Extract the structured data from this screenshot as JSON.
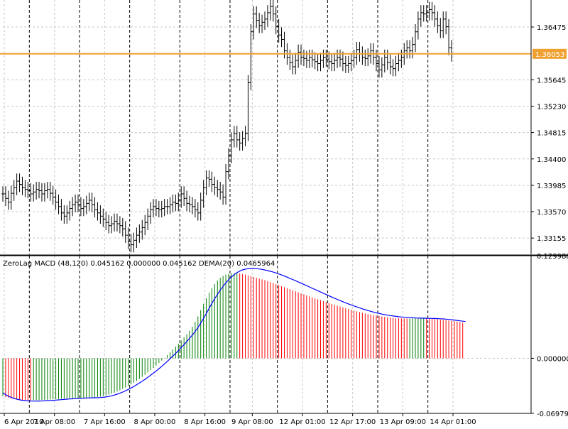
{
  "chart_data": [
    {
      "type": "ohlc",
      "title": "",
      "ylim": [
        1.329,
        1.369
      ],
      "y_ticks": [
        1.33155,
        1.3357,
        1.33985,
        1.344,
        1.34815,
        1.3523,
        1.35645,
        1.36475
      ],
      "y_tick_labels": [
        "1.33155",
        "1.33570",
        "1.33985",
        "1.34400",
        "1.34815",
        "1.35230",
        "1.35645",
        "1.36475"
      ],
      "current_price": 1.36053,
      "current_price_label": "1.36053",
      "price_line_color": "#f0a030",
      "bar_color": "#000000",
      "series": [
        {
          "close": [
            1.3385,
            1.3378,
            1.3372,
            1.3386,
            1.3395,
            1.3405,
            1.34,
            1.3395,
            1.3392,
            1.339,
            1.3385,
            1.3388,
            1.3392,
            1.339,
            1.3385,
            1.339,
            1.3392,
            1.3386,
            1.338,
            1.3372,
            1.3365,
            1.3355,
            1.335,
            1.3355,
            1.3362,
            1.3368,
            1.3372,
            1.3368,
            1.3362,
            1.3365,
            1.337,
            1.3375,
            1.3368,
            1.336,
            1.3355,
            1.335,
            1.3345,
            1.334,
            1.3335,
            1.3338,
            1.3342,
            1.3338,
            1.3335,
            1.333,
            1.332,
            1.331,
            1.3305,
            1.3312,
            1.332,
            1.3325,
            1.3332,
            1.334,
            1.335,
            1.336,
            1.3365,
            1.3362,
            1.336,
            1.3362,
            1.3365,
            1.3365,
            1.3368,
            1.3372,
            1.337,
            1.3375,
            1.3385,
            1.3378,
            1.337,
            1.3368,
            1.3365,
            1.336,
            1.3355,
            1.3375,
            1.3395,
            1.341,
            1.3408,
            1.34,
            1.3395,
            1.3392,
            1.3388,
            1.338,
            1.342,
            1.3445,
            1.347,
            1.348,
            1.347,
            1.3465,
            1.3472,
            1.348,
            1.356,
            1.364,
            1.3668,
            1.3658,
            1.365,
            1.3655,
            1.366,
            1.367,
            1.368,
            1.3668,
            1.3648,
            1.3635,
            1.3628,
            1.361,
            1.36,
            1.3592,
            1.3585,
            1.3595,
            1.3608,
            1.36,
            1.3598,
            1.3595,
            1.36,
            1.3596,
            1.3593,
            1.359,
            1.3595,
            1.36,
            1.3597,
            1.3593,
            1.359,
            1.3595,
            1.36,
            1.3597,
            1.359,
            1.3587,
            1.359,
            1.3595,
            1.36,
            1.3612,
            1.3605,
            1.36,
            1.3598,
            1.3602,
            1.361,
            1.36,
            1.359,
            1.358,
            1.3588,
            1.36,
            1.3592,
            1.3585,
            1.3582,
            1.359,
            1.3595,
            1.36,
            1.361,
            1.3615,
            1.361,
            1.362,
            1.364,
            1.366,
            1.367,
            1.3668,
            1.367,
            1.3675,
            1.367,
            1.366,
            1.365,
            1.3642,
            1.366,
            1.3648,
            1.3615,
            1.3605
          ]
        }
      ],
      "x_tick_labels": [
        "6 Apr 2010",
        "7 Apr 08:00",
        "7 Apr 16:00",
        "8 Apr 00:00",
        "8 Apr 16:00",
        "9 Apr 08:00",
        "12 Apr 01:00",
        "12 Apr 17:00",
        "13 Apr 09:00",
        "14 Apr 01:00"
      ],
      "period_separators": 9
    },
    {
      "type": "bar",
      "title": "ZeroLag MACD (48,120) 0.045162 0.000000 0.045162 DEMA(20) 0.0465964",
      "ylim": [
        -0.06979,
        0.129988
      ],
      "y_ticks": [
        0.129988,
        0.0,
        -0.06979
      ],
      "y_tick_labels": [
        "0.129988",
        "0.000000",
        "-0.069790"
      ],
      "series": [
        {
          "name": "ZeroLag MACD",
          "colors": {
            "rising": "#008000",
            "falling": "#ff0000"
          },
          "values": [
            -0.048,
            -0.049,
            -0.05,
            -0.0508,
            -0.0515,
            -0.052,
            -0.0525,
            -0.0528,
            -0.053,
            -0.0532,
            -0.0533,
            -0.0532,
            -0.0531,
            -0.053,
            -0.0528,
            -0.0526,
            -0.0524,
            -0.0522,
            -0.052,
            -0.0518,
            -0.0515,
            -0.0513,
            -0.0511,
            -0.051,
            -0.0508,
            -0.0507,
            -0.0506,
            -0.0505,
            -0.0504,
            -0.0503,
            -0.0502,
            -0.05,
            -0.0497,
            -0.0494,
            -0.049,
            -0.0485,
            -0.0478,
            -0.047,
            -0.046,
            -0.0448,
            -0.0435,
            -0.042,
            -0.0405,
            -0.0388,
            -0.037,
            -0.035,
            -0.033,
            -0.0308,
            -0.0285,
            -0.026,
            -0.0235,
            -0.0208,
            -0.018,
            -0.0152,
            -0.0122,
            -0.0092,
            -0.006,
            -0.0028,
            0.0005,
            0.004,
            0.0075,
            0.011,
            0.0148,
            0.0185,
            0.0225,
            0.0265,
            0.0305,
            0.035,
            0.04,
            0.046,
            0.053,
            0.061,
            0.069,
            0.076,
            0.083,
            0.089,
            0.094,
            0.0985,
            0.102,
            0.1045,
            0.106,
            0.107,
            0.1075,
            0.1078,
            0.108,
            0.1075,
            0.1068,
            0.106,
            0.105,
            0.104,
            0.103,
            0.102,
            0.101,
            0.1,
            0.099,
            0.0978,
            0.0966,
            0.0953,
            0.094,
            0.0927,
            0.0914,
            0.0901,
            0.0888,
            0.0875,
            0.0862,
            0.0849,
            0.0836,
            0.0823,
            0.081,
            0.0797,
            0.0784,
            0.0772,
            0.076,
            0.0748,
            0.0736,
            0.0724,
            0.0712,
            0.07,
            0.0689,
            0.0678,
            0.0667,
            0.0656,
            0.0645,
            0.0634,
            0.0624,
            0.0614,
            0.0604,
            0.0594,
            0.0585,
            0.0576,
            0.0568,
            0.056,
            0.0553,
            0.0546,
            0.054,
            0.0534,
            0.0529,
            0.0524,
            0.052,
            0.0516,
            0.0513,
            0.051,
            0.0508,
            0.0506,
            0.0505,
            0.0504,
            0.0504,
            0.0505,
            0.0507,
            0.051,
            0.0512,
            0.0513,
            0.0512,
            0.0508,
            0.0503,
            0.0498,
            0.0494,
            0.049,
            0.0486,
            0.0482,
            0.0478,
            0.0474,
            0.047,
            0.0466,
            0.046,
            0.0452
          ]
        },
        {
          "name": "DEMA(20)",
          "color": "#0000ff",
          "values": [
            -0.044,
            -0.046,
            -0.048,
            -0.0495,
            -0.0508,
            -0.0518,
            -0.0526,
            -0.0532,
            -0.0536,
            -0.0539,
            -0.0541,
            -0.0542,
            -0.0542,
            -0.0541,
            -0.054,
            -0.0538,
            -0.0536,
            -0.0534,
            -0.0532,
            -0.053,
            -0.0527,
            -0.0524,
            -0.0521,
            -0.0518,
            -0.0515,
            -0.0513,
            -0.0511,
            -0.0509,
            -0.0507,
            -0.0505,
            -0.0503,
            -0.0502,
            -0.0501,
            -0.05,
            -0.0499,
            -0.0497,
            -0.0494,
            -0.049,
            -0.0484,
            -0.0476,
            -0.0466,
            -0.0455,
            -0.0442,
            -0.0428,
            -0.0412,
            -0.0395,
            -0.0377,
            -0.0357,
            -0.0336,
            -0.0314,
            -0.0291,
            -0.0267,
            -0.0242,
            -0.0216,
            -0.0189,
            -0.0161,
            -0.0132,
            -0.0102,
            -0.0071,
            -0.0039,
            -0.0006,
            0.0028,
            0.0062,
            0.0098,
            0.0135,
            0.0173,
            0.0212,
            0.0252,
            0.0295,
            0.034,
            0.039,
            0.0445,
            0.0505,
            0.0568,
            0.0632,
            0.0695,
            0.0755,
            0.081,
            0.0862,
            0.091,
            0.0955,
            0.0995,
            0.103,
            0.106,
            0.1085,
            0.1105,
            0.112,
            0.113,
            0.1135,
            0.1138,
            0.1138,
            0.1136,
            0.1132,
            0.1126,
            0.1119,
            0.1111,
            0.1102,
            0.1092,
            0.1081,
            0.1069,
            0.1056,
            0.1042,
            0.1028,
            0.1013,
            0.0998,
            0.0983,
            0.0968,
            0.0952,
            0.0936,
            0.092,
            0.0904,
            0.0888,
            0.0872,
            0.0856,
            0.084,
            0.0824,
            0.0808,
            0.0792,
            0.0776,
            0.0761,
            0.0746,
            0.0731,
            0.0717,
            0.0703,
            0.0689,
            0.0676,
            0.0663,
            0.0651,
            0.0639,
            0.0627,
            0.0616,
            0.0605,
            0.0595,
            0.0585,
            0.0576,
            0.0568,
            0.056,
            0.0553,
            0.0547,
            0.0541,
            0.0536,
            0.0531,
            0.0527,
            0.0523,
            0.052,
            0.0517,
            0.0515,
            0.0513,
            0.0511,
            0.051,
            0.0509,
            0.0508,
            0.0507,
            0.0506,
            0.0505,
            0.0504,
            0.0503,
            0.0501,
            0.0499,
            0.0496,
            0.0493,
            0.0489,
            0.0485,
            0.048,
            0.0475,
            0.047,
            0.0466
          ]
        }
      ]
    }
  ]
}
